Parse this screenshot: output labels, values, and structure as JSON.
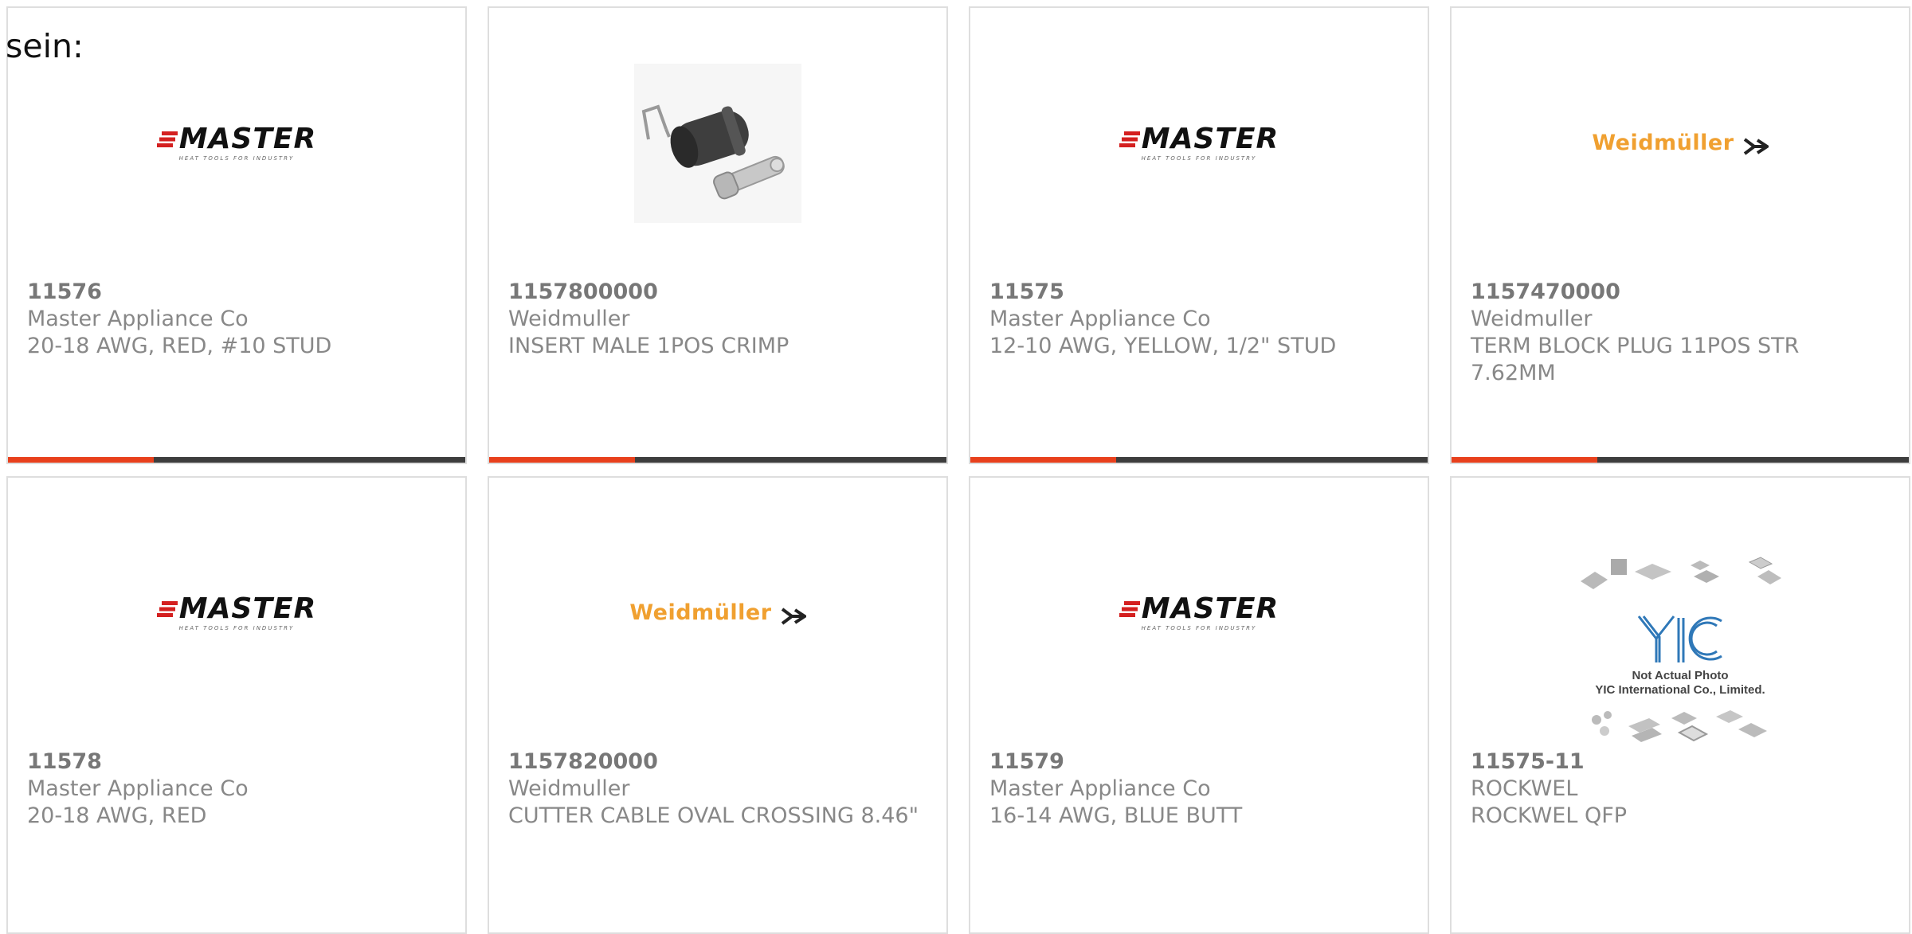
{
  "intro_text": "sein:",
  "accent_color": "#e8401c",
  "cards": [
    {
      "part": "11576",
      "manufacturer": "Master Appliance Co",
      "description": "20-18 AWG, RED, #10 STUD",
      "logo": "master-logo"
    },
    {
      "part": "1157800000",
      "manufacturer": "Weidmuller",
      "description": "INSERT MALE 1POS CRIMP",
      "logo": "connector-photo"
    },
    {
      "part": "11575",
      "manufacturer": "Master Appliance Co",
      "description": "12-10 AWG, YELLOW, 1/2\" STUD",
      "logo": "master-logo"
    },
    {
      "part": "1157470000",
      "manufacturer": "Weidmuller",
      "description": "TERM BLOCK PLUG 11POS STR 7.62MM",
      "logo": "weidmuller-logo"
    },
    {
      "part": "11578",
      "manufacturer": "Master Appliance Co",
      "description": "20-18 AWG, RED",
      "logo": "master-logo"
    },
    {
      "part": "1157820000",
      "manufacturer": "Weidmuller",
      "description": "CUTTER CABLE OVAL CROSSING 8.46\"",
      "logo": "weidmuller-logo"
    },
    {
      "part": "11579",
      "manufacturer": "Master Appliance Co",
      "description": "16-14 AWG, BLUE BUTT",
      "logo": "master-logo"
    },
    {
      "part": "11575-11",
      "manufacturer": "ROCKWEL",
      "description": "ROCKWEL QFP",
      "logo": "yic-placeholder"
    }
  ],
  "logos": {
    "master": {
      "name": "MASTER",
      "tagline": "HEAT TOOLS FOR INDUSTRY"
    },
    "weidmuller": {
      "name": "Weidmüller"
    },
    "yic": {
      "mark": "YIC",
      "line1": "Not Actual Photo",
      "line2": "YIC International Co., Limited."
    }
  }
}
